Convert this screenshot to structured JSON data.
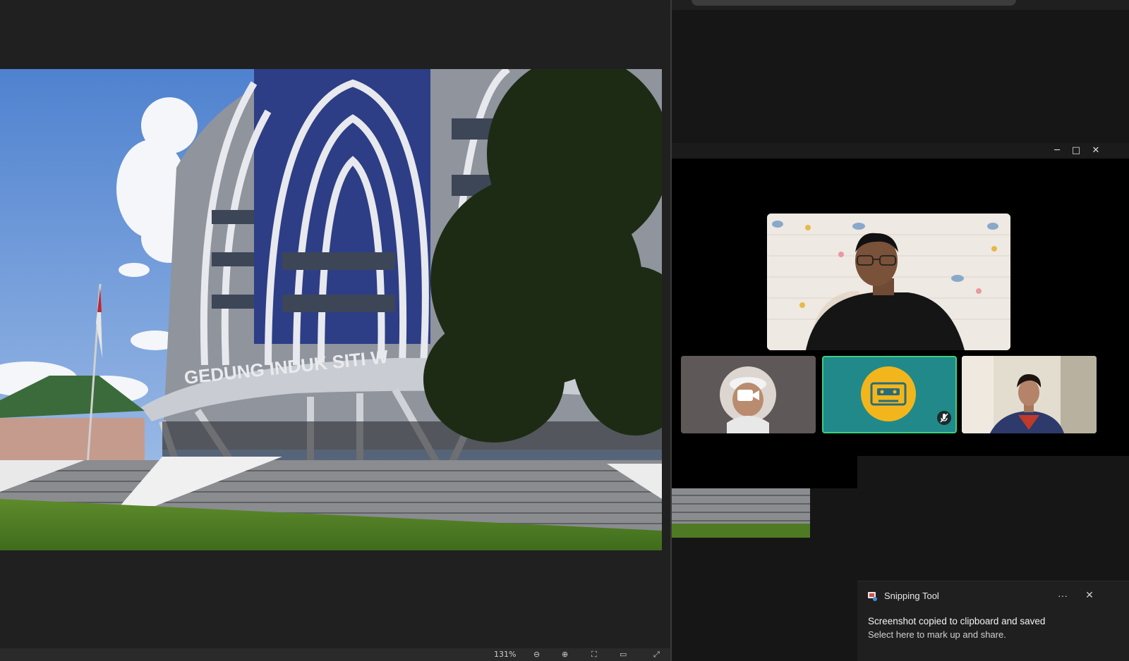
{
  "viewer": {
    "zoom": "131%",
    "photo_sign": "GEDUNG INDUK SITI W"
  },
  "meeting": {
    "window_controls": [
      "minimize",
      "maximize",
      "close"
    ],
    "participants": [
      {
        "kind": "video",
        "id": "speaker"
      },
      {
        "kind": "avatar-camera-off",
        "id": "tile1"
      },
      {
        "kind": "audio-avatar",
        "id": "tile2",
        "muted": true
      },
      {
        "kind": "video",
        "id": "tile3"
      }
    ]
  },
  "toast": {
    "app_name": "Snipping Tool",
    "more": "···",
    "close": "✕",
    "title": "Screenshot copied to clipboard and saved",
    "body": "Select here to mark up and share."
  },
  "colors": {
    "accent_tile": "#21898a",
    "active_border": "#3ed07a",
    "cassette_circle": "#f2b61c"
  }
}
